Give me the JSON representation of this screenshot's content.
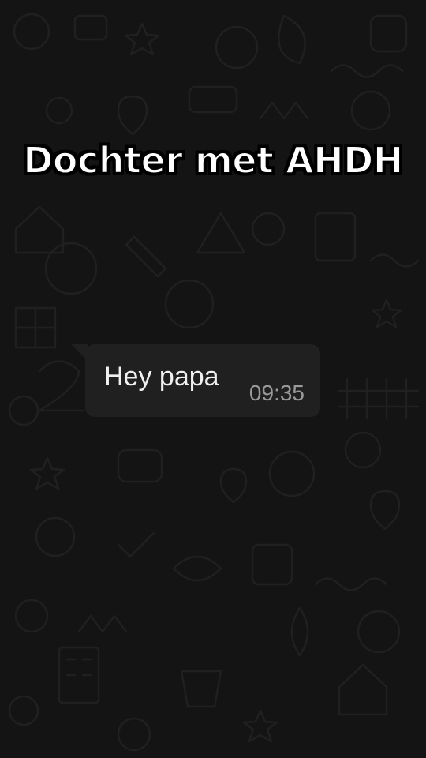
{
  "title": "Dochter met AHDH",
  "message": {
    "text": "Hey papa",
    "time": "09:35"
  },
  "colors": {
    "background": "#141414",
    "bubble": "#202020",
    "title_fill": "#ffffff",
    "title_outline": "#000000",
    "message_text": "#f0f0f0",
    "timestamp": "#9a9a9a"
  }
}
